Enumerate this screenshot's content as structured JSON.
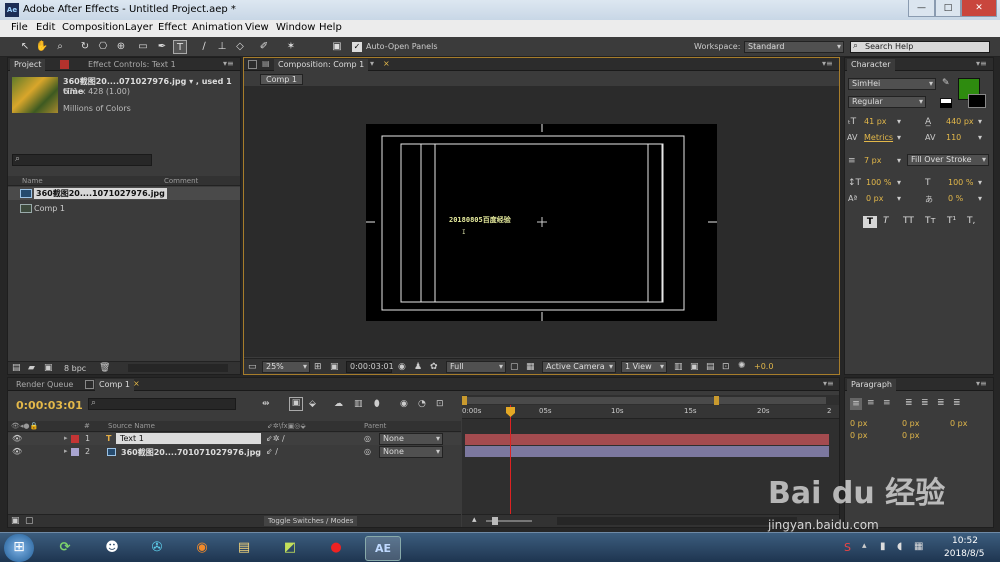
{
  "window": {
    "title": "Adobe After Effects - Untitled Project.aep *",
    "app_icon": "Ae",
    "buttons": [
      "—",
      "□",
      "✕"
    ]
  },
  "menu": [
    "File",
    "Edit",
    "Composition",
    "Layer",
    "Effect",
    "Animation",
    "View",
    "Window",
    "Help"
  ],
  "toolbar": {
    "auto_open_label": "Auto-Open Panels",
    "workspace_label": "Workspace:",
    "workspace_value": "Standard",
    "search_placeholder": "Search Help"
  },
  "project": {
    "tab_project": "Project",
    "tab_effects": "Effect Controls: Text 1",
    "item_name": "360截图20....071027976.jpg ▾ , used 1 time",
    "item_dims": "671 x 428 (1.00)",
    "item_colors": "Millions of Colors",
    "col_name": "Name",
    "col_comment": "Comment",
    "items": [
      "360截图20....1071027976.jpg",
      "Comp 1"
    ],
    "bpc": "8 bpc"
  },
  "composition": {
    "tab": "Composition: Comp 1",
    "breadcrumb": "Comp 1",
    "text_layer": "20180805百度经验",
    "zoom": "25%",
    "timecode": "0:00:03:01",
    "resolution": "Full",
    "camera": "Active Camera",
    "views": "1 View",
    "exposure": "+0.0"
  },
  "character": {
    "tab": "Character",
    "font": "SimHei",
    "style": "Regular",
    "font_size": "41 px",
    "leading": "440 px",
    "kerning": "Metrics",
    "tracking": "110",
    "stroke_width": "7 px",
    "stroke_mode": "Fill Over Stroke",
    "vscale": "100 %",
    "hscale": "100 %",
    "baseline": "0 px",
    "tsume": "0 %",
    "style_buttons": [
      "T",
      "T",
      "TT",
      "Tт",
      "T¹",
      "T,"
    ],
    "fill_color": "#2e8b0f"
  },
  "paragraph": {
    "tab": "Paragraph",
    "values": [
      "0 px",
      "0 px",
      "0 px",
      "0 px",
      "0 px"
    ]
  },
  "timeline": {
    "tab_render": "Render Queue",
    "tab_comp": "Comp 1",
    "timecode": "0:00:03:01",
    "col_num": "#",
    "col_source": "Source Name",
    "col_parent": "Parent",
    "layers": [
      {
        "num": "1",
        "name": "Text 1",
        "parent": "None"
      },
      {
        "num": "2",
        "name": "360截图20....701071027976.jpg",
        "parent": "None"
      }
    ],
    "ruler": [
      "0:00s",
      "05s",
      "10s",
      "15s",
      "20s",
      "2"
    ],
    "toggle_label": "Toggle Switches / Modes"
  },
  "taskbar": {
    "time": "10:52",
    "date": "2018/8/5",
    "ae_label": "AE"
  },
  "watermark": {
    "brand": "Bai du 经验",
    "url": "jingyan.baidu.com"
  }
}
